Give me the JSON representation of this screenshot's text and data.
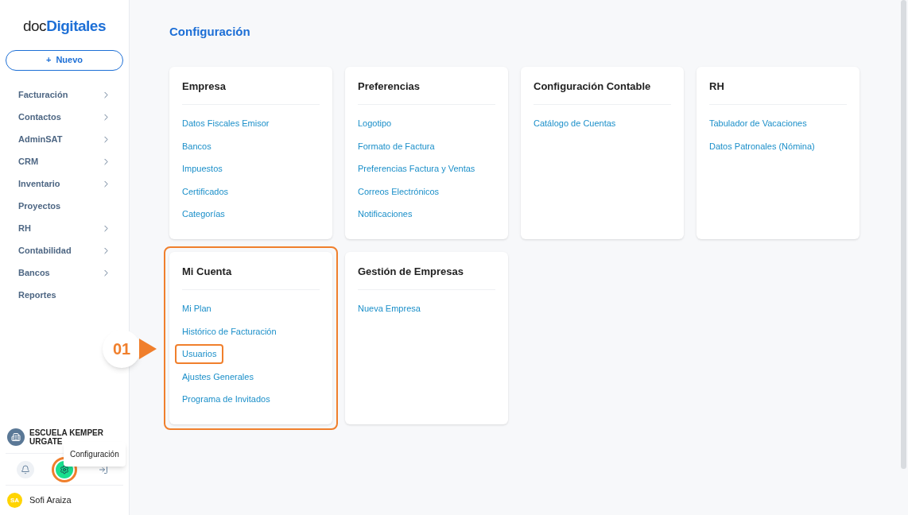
{
  "sidebar": {
    "logo": {
      "light": "doc",
      "bold": "Digitales"
    },
    "new_button": {
      "icon": "+",
      "label": "Nuevo"
    },
    "items": [
      {
        "label": "Facturación",
        "has_submenu": true
      },
      {
        "label": "Contactos",
        "has_submenu": true
      },
      {
        "label": "AdminSAT",
        "has_submenu": true
      },
      {
        "label": "CRM",
        "has_submenu": true
      },
      {
        "label": "Inventario",
        "has_submenu": true
      },
      {
        "label": "Proyectos",
        "has_submenu": false
      },
      {
        "label": "RH",
        "has_submenu": true
      },
      {
        "label": "Contabilidad",
        "has_submenu": true
      },
      {
        "label": "Bancos",
        "has_submenu": true
      },
      {
        "label": "Reportes",
        "has_submenu": false
      }
    ],
    "company": "ESCUELA KEMPER URGATE",
    "tooltip": "Configuración",
    "actions": [
      {
        "kind": "bell",
        "selected": false,
        "highlighted": false
      },
      {
        "kind": "gear",
        "selected": true,
        "highlighted": true
      },
      {
        "kind": "logout",
        "selected": false,
        "highlighted": false
      }
    ],
    "user": {
      "initials": "SA",
      "name": "Sofi Araiza"
    }
  },
  "page": {
    "title": "Configuración",
    "callout": {
      "label": "01"
    },
    "cards": [
      {
        "title": "Empresa",
        "highlighted": false,
        "links": [
          {
            "label": "Datos Fiscales Emisor",
            "highlighted": false
          },
          {
            "label": "Bancos",
            "highlighted": false
          },
          {
            "label": "Impuestos",
            "highlighted": false
          },
          {
            "label": "Certificados",
            "highlighted": false
          },
          {
            "label": "Categorías",
            "highlighted": false
          }
        ]
      },
      {
        "title": "Preferencias",
        "highlighted": false,
        "links": [
          {
            "label": "Logotipo",
            "highlighted": false
          },
          {
            "label": "Formato de Factura",
            "highlighted": false
          },
          {
            "label": "Preferencias Factura y Ventas",
            "highlighted": false
          },
          {
            "label": "Correos Electrónicos",
            "highlighted": false
          },
          {
            "label": "Notificaciones",
            "highlighted": false
          }
        ]
      },
      {
        "title": "Configuración Contable",
        "highlighted": false,
        "links": [
          {
            "label": "Catálogo de Cuentas",
            "highlighted": false
          }
        ]
      },
      {
        "title": "RH",
        "highlighted": false,
        "links": [
          {
            "label": "Tabulador de Vacaciones",
            "highlighted": false
          },
          {
            "label": "Datos Patronales (Nómina)",
            "highlighted": false
          }
        ]
      },
      {
        "title": "Mi Cuenta",
        "highlighted": true,
        "links": [
          {
            "label": "Mi Plan",
            "highlighted": false
          },
          {
            "label": "Histórico de Facturación",
            "highlighted": false
          },
          {
            "label": "Usuarios",
            "highlighted": true
          },
          {
            "label": "Ajustes Generales",
            "highlighted": false
          },
          {
            "label": "Programa de Invitados",
            "highlighted": false
          }
        ]
      },
      {
        "title": "Gestión de Empresas",
        "highlighted": false,
        "links": [
          {
            "label": "Nueva Empresa",
            "highlighted": false
          }
        ]
      }
    ]
  }
}
